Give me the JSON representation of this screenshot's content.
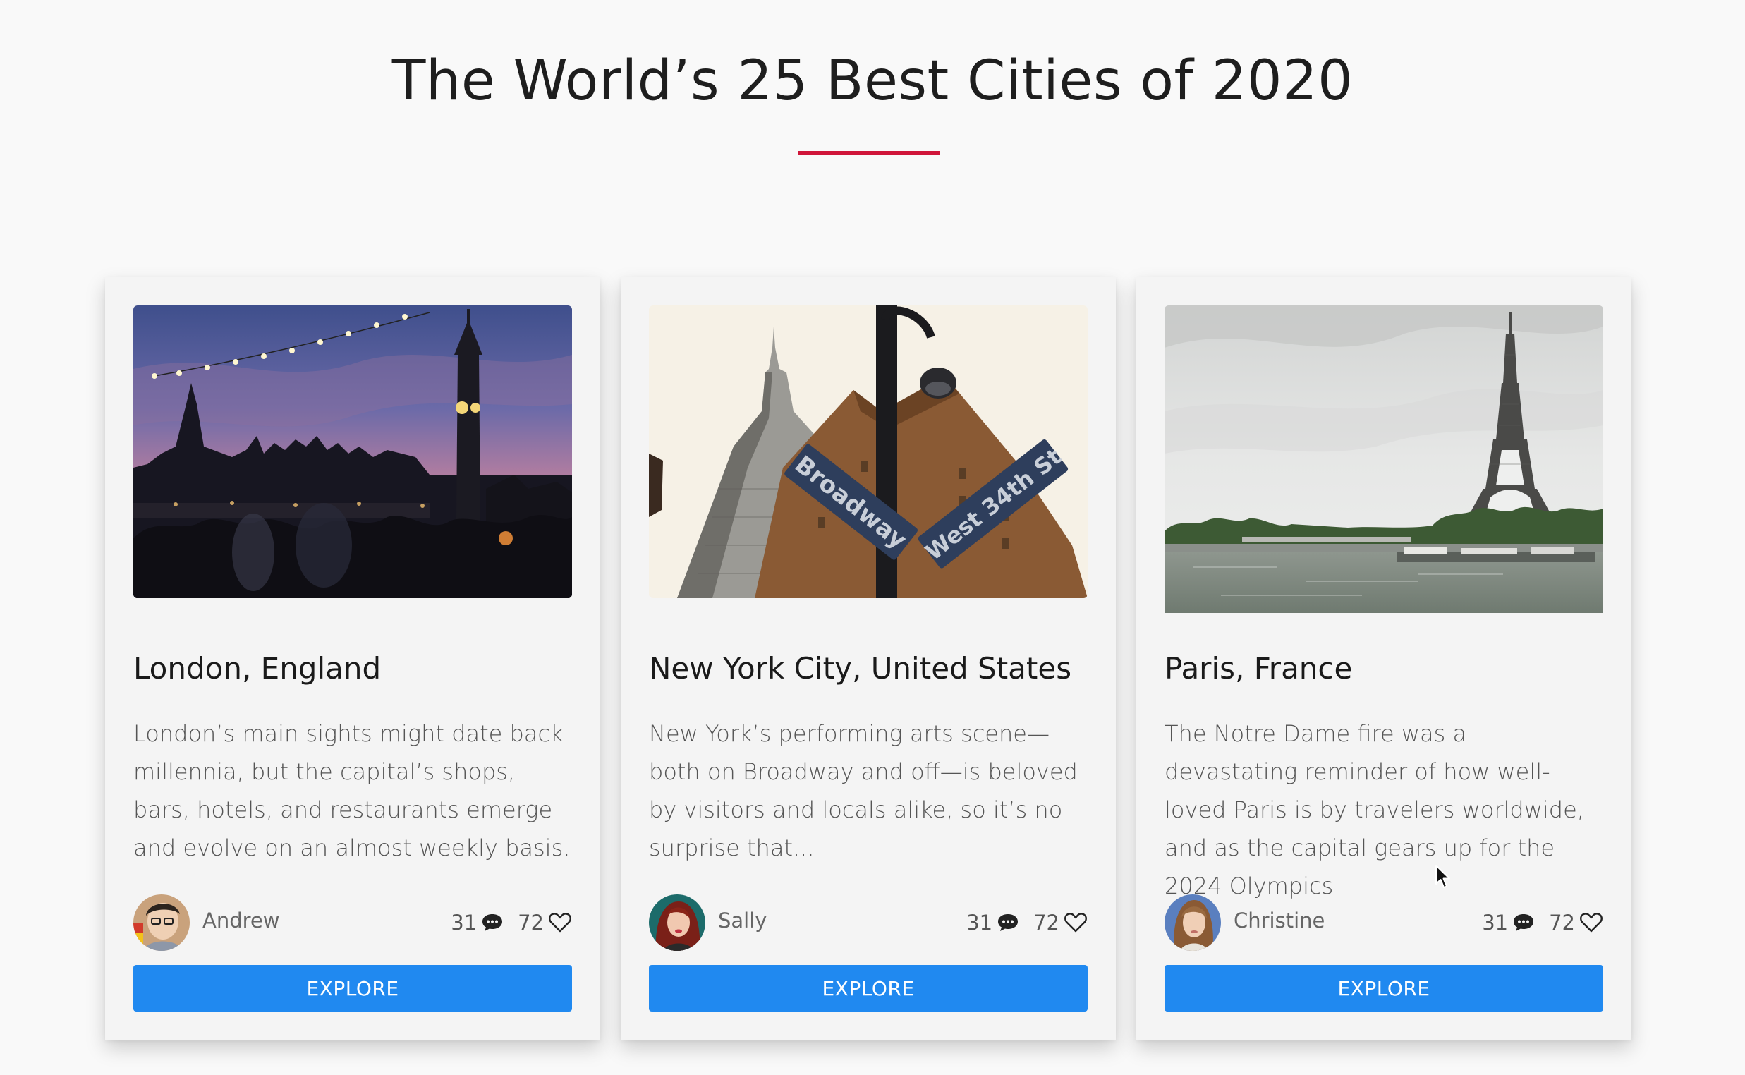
{
  "page": {
    "title": "The World’s 25 Best Cities of 2020"
  },
  "colors": {
    "accent": "#d0163a",
    "button": "#2089f0",
    "card_bg": "#f4f4f4",
    "page_bg": "#f9f9f9"
  },
  "cards": [
    {
      "city": "London, England",
      "description": "London’s main sights might date back millennia, but the capital’s shops, bars, hotels, and restaurants emerge and evolve on an almost weekly basis.",
      "author": "Andrew",
      "comments": "31",
      "likes": "72",
      "button": "EXPLORE",
      "image": "london-big-ben-dusk-photo"
    },
    {
      "city": "New York City, United States",
      "description": "New York’s performing arts scene—both on Broadway and off—is beloved by visitors and locals alike, so it’s no surprise that...",
      "author": "Sally",
      "comments": "31",
      "likes": "72",
      "button": "EXPLORE",
      "image": "new-york-street-signs-photo",
      "sign_left": "Broadway",
      "sign_right": "West 34th St"
    },
    {
      "city": "Paris, France",
      "description": "The Notre Dame fire was a devastating reminder of how well-loved Paris is by travelers worldwide, and as the capital gears up for the 2024 Olympics",
      "author": "Christine",
      "comments": "31",
      "likes": "72",
      "button": "EXPLORE",
      "image": "paris-eiffel-tower-seine-photo"
    }
  ],
  "icons": {
    "comment": "comment-bubble-icon",
    "like": "heart-outline-icon",
    "cursor": "mouse-pointer-icon"
  }
}
